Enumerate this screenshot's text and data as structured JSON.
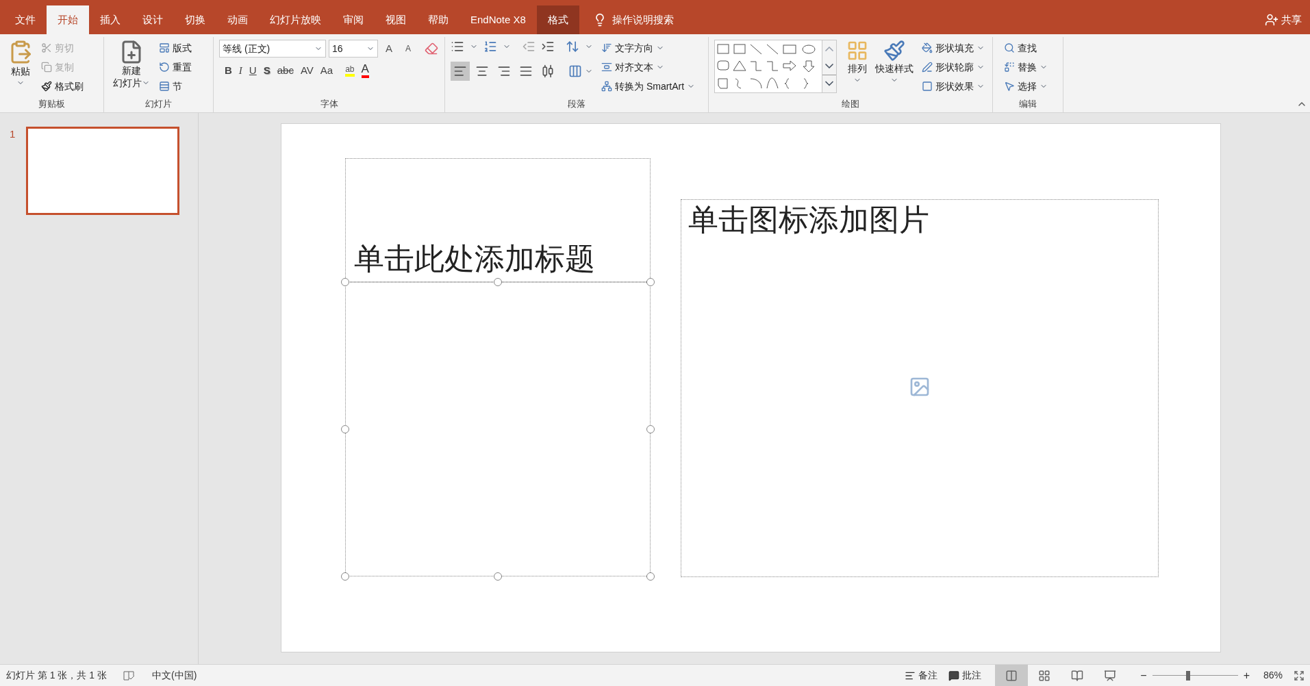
{
  "tabs": [
    {
      "label": "文件",
      "selected": false,
      "kind": "file"
    },
    {
      "label": "开始",
      "selected": true,
      "kind": "normal"
    },
    {
      "label": "插入",
      "selected": false,
      "kind": "normal"
    },
    {
      "label": "设计",
      "selected": false,
      "kind": "normal"
    },
    {
      "label": "切换",
      "selected": false,
      "kind": "normal"
    },
    {
      "label": "动画",
      "selected": false,
      "kind": "normal"
    },
    {
      "label": "幻灯片放映",
      "selected": false,
      "kind": "normal"
    },
    {
      "label": "审阅",
      "selected": false,
      "kind": "normal"
    },
    {
      "label": "视图",
      "selected": false,
      "kind": "normal"
    },
    {
      "label": "帮助",
      "selected": false,
      "kind": "normal"
    },
    {
      "label": "EndNote X8",
      "selected": false,
      "kind": "normal"
    },
    {
      "label": "格式",
      "selected": false,
      "kind": "contextual"
    }
  ],
  "tell_me": "操作说明搜索",
  "share": "共享",
  "clipboard": {
    "title": "剪贴板",
    "paste": "粘贴",
    "items": [
      {
        "label": "剪切",
        "disabled": true,
        "kind": "cut"
      },
      {
        "label": "复制",
        "disabled": true,
        "kind": "copy"
      },
      {
        "label": "格式刷",
        "disabled": false,
        "kind": "painter"
      }
    ]
  },
  "slides_group": {
    "title": "幻灯片",
    "new_slide": "新建",
    "new_slide_2": "幻灯片",
    "items": [
      {
        "label": "版式",
        "kind": "layout"
      },
      {
        "label": "重置",
        "kind": "reset"
      },
      {
        "label": "节",
        "kind": "section"
      }
    ]
  },
  "font": {
    "title": "字体",
    "font_name": "等线 (正文)",
    "font_size": "16",
    "grow": "A",
    "shrink": "A",
    "buttons": [
      {
        "label": "B",
        "kind": "bold"
      },
      {
        "label": "I",
        "kind": "italic"
      },
      {
        "label": "U",
        "kind": "underline"
      },
      {
        "label": "S",
        "kind": "shadow"
      },
      {
        "label": "abc",
        "kind": "strike"
      },
      {
        "label": "AV",
        "kind": "spacing"
      },
      {
        "label": "Aa",
        "kind": "case"
      }
    ],
    "highlight": "ab",
    "font_color": "A"
  },
  "paragraph": {
    "title": "段落",
    "alignments": [
      {
        "kind": "left",
        "selected": true
      },
      {
        "kind": "center",
        "selected": false
      },
      {
        "kind": "right",
        "selected": false
      },
      {
        "kind": "justify",
        "selected": false
      },
      {
        "kind": "distributed",
        "selected": false
      }
    ],
    "items": [
      {
        "label": "文字方向",
        "kind": "direction"
      },
      {
        "label": "对齐文本",
        "kind": "align"
      },
      {
        "label": "转换为 SmartArt",
        "kind": "smartart"
      }
    ]
  },
  "drawing": {
    "title": "绘图",
    "arrange": "排列",
    "quick_styles": "快速样式",
    "items": [
      {
        "label": "形状填充",
        "kind": "fill"
      },
      {
        "label": "形状轮廓",
        "kind": "outline"
      },
      {
        "label": "形状效果",
        "kind": "effects"
      }
    ]
  },
  "editing": {
    "title": "编辑",
    "items": [
      {
        "label": "查找",
        "kind": "find",
        "caret": false
      },
      {
        "label": "替换",
        "kind": "replace",
        "caret": true
      },
      {
        "label": "选择",
        "kind": "select",
        "caret": true
      }
    ]
  },
  "thumbnails": [
    {
      "number": "1",
      "selected": true
    }
  ],
  "slide": {
    "title_placeholder": "单击此处添加标题",
    "body_selected": true,
    "picture_placeholder": "单击图标添加图片"
  },
  "status_bar": {
    "slide_info": "幻灯片 第 1 张，共 1 张",
    "language": "中文(中国)",
    "notes": "备注",
    "comments": "批注",
    "views": [
      {
        "kind": "normal",
        "selected": true
      },
      {
        "kind": "sorter",
        "selected": false
      },
      {
        "kind": "reading",
        "selected": false
      },
      {
        "kind": "slideshow",
        "selected": false
      }
    ],
    "zoom_minus": "−",
    "zoom_plus": "+",
    "zoom": {
      "level": 0.42
    },
    "zoom_text": "86%"
  }
}
